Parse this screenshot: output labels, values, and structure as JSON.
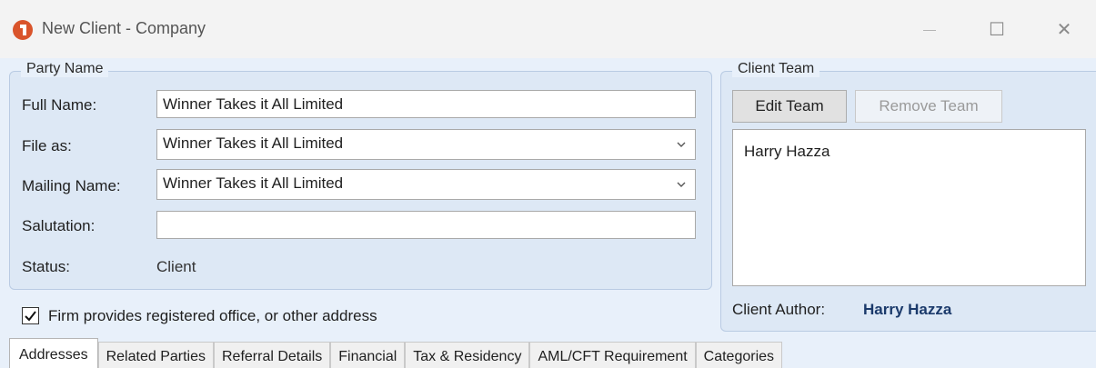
{
  "window": {
    "title": "New Client - Company",
    "minimize_glyph": "—",
    "maximize_glyph": "☐",
    "close_glyph": "✕"
  },
  "party_name": {
    "legend": "Party Name",
    "full_name_label": "Full Name:",
    "full_name_value": "Winner Takes it All Limited",
    "file_as_label": "File as:",
    "file_as_value": "Winner Takes it All Limited",
    "mailing_name_label": "Mailing Name:",
    "mailing_name_value": "Winner Takes it All Limited",
    "salutation_label": "Salutation:",
    "salutation_value": "",
    "status_label": "Status:",
    "status_value": "Client"
  },
  "registered_office": {
    "checked": true,
    "label": "Firm provides registered office, or other address"
  },
  "client_team": {
    "legend": "Client Team",
    "edit_button": "Edit Team",
    "remove_button": "Remove Team",
    "members": [
      "Harry Hazza"
    ],
    "author_label": "Client Author:",
    "author_value": "Harry Hazza"
  },
  "tabs": [
    {
      "label": "Addresses",
      "active": true
    },
    {
      "label": "Related Parties",
      "active": false
    },
    {
      "label": "Referral Details",
      "active": false
    },
    {
      "label": "Financial",
      "active": false
    },
    {
      "label": "Tax & Residency",
      "active": false
    },
    {
      "label": "AML/CFT Requirement",
      "active": false
    },
    {
      "label": "Categories",
      "active": false
    }
  ],
  "colors": {
    "accent_text": "#1b3a6b",
    "app_icon": "#d9542b"
  }
}
